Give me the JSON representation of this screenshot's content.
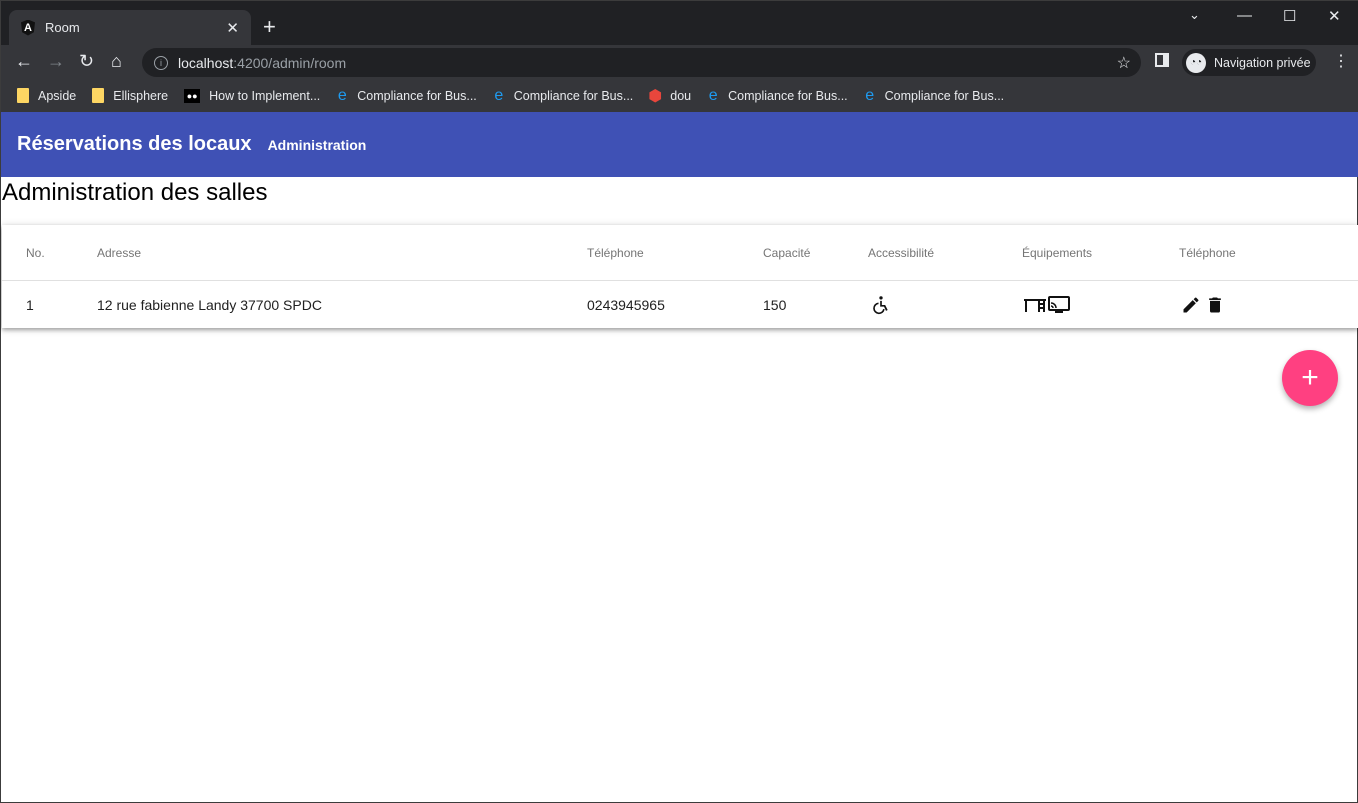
{
  "browser": {
    "tab_title": "Room",
    "url_host": "localhost",
    "url_path": ":4200/admin/room",
    "profile": "Navigation privée",
    "bookmarks": [
      {
        "label": "Apside",
        "icon": "folder-icon"
      },
      {
        "label": "Ellisphere",
        "icon": "folder-icon"
      },
      {
        "label": "How to Implement...",
        "icon": "medium-icon"
      },
      {
        "label": "Compliance for Bus...",
        "icon": "edge-icon"
      },
      {
        "label": "Compliance for Bus...",
        "icon": "edge-icon"
      },
      {
        "label": "dou",
        "icon": "app-icon"
      },
      {
        "label": "Compliance for Bus...",
        "icon": "edge-icon"
      },
      {
        "label": "Compliance for Bus...",
        "icon": "edge-icon"
      }
    ]
  },
  "app": {
    "title": "Réservations des locaux",
    "nav_admin": "Administration",
    "primary_color": "#3f51b5",
    "accent_color": "#ff4081"
  },
  "page": {
    "title": "Administration des salles"
  },
  "table": {
    "columns": [
      "No.",
      "Adresse",
      "Téléphone",
      "Capacité",
      "Accessibilité",
      "Équipements",
      "Téléphone"
    ],
    "rows": [
      {
        "no": "1",
        "address": "12 rue fabienne Landy 37700 SPDC",
        "phone": "0243945965",
        "capacity": "150",
        "accessibility": "wheelchair-icon",
        "equipment": [
          "desk-icon",
          "cast-screen-icon"
        ],
        "actions": [
          "edit-icon",
          "delete-icon"
        ]
      }
    ]
  },
  "fab": {
    "label": "+"
  }
}
